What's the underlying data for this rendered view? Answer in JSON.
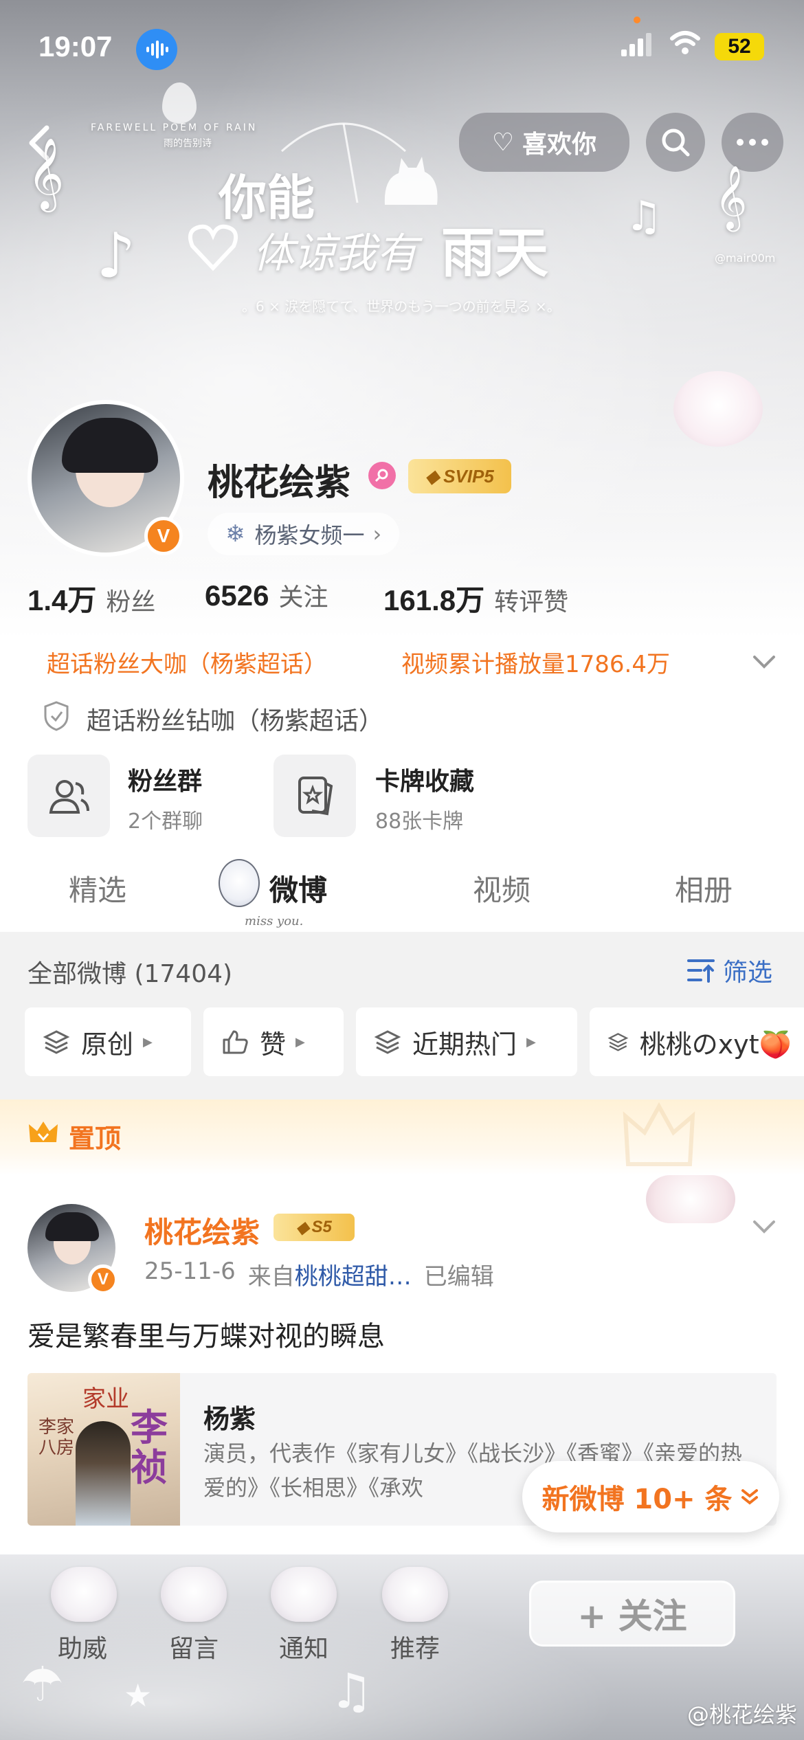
{
  "status_bar": {
    "time": "19:07",
    "battery": "52"
  },
  "hero": {
    "like_you": "喜欢你",
    "small_brand": "FAREWELL POEM OF RAIN",
    "small_brand_cn": "雨的告别诗",
    "title_line1": "你能",
    "title_line2_a": "体谅我有",
    "title_line2_b": "雨天",
    "subtitle": "。6 × 涙を隠てて、世界のもう一つの前を見る ×。",
    "watermark": "@mair00m"
  },
  "profile": {
    "name": "桃花绘紫",
    "verified_badge": "V",
    "svip": "SVIP5",
    "group_tag": "杨紫女频一",
    "stats": [
      {
        "num": "1.4万",
        "label": "粉丝"
      },
      {
        "num": "6526",
        "label": "关注"
      },
      {
        "num": "161.8万",
        "label": "转评赞"
      }
    ],
    "honors": [
      "超话粉丝大咖（杨紫超话）",
      "视频累计播放量1786.4万"
    ],
    "diamond": "超话粉丝钻咖（杨紫超话）",
    "features": [
      {
        "title": "粉丝群",
        "sub": "2个群聊"
      },
      {
        "title": "卡牌收藏",
        "sub": "88张卡牌"
      }
    ]
  },
  "tabs": [
    "精选",
    "微博",
    "视频",
    "相册"
  ],
  "tab_deco": "miss you.",
  "filter": {
    "all_label": "全部微博 (17404)",
    "filter_btn": "筛选",
    "chips": [
      "原创",
      "赞",
      "近期热门",
      "桃桃のxyt🍑"
    ]
  },
  "pinned": {
    "label": "置顶"
  },
  "post": {
    "author": "桃花绘紫",
    "level": "S5",
    "date": "25-11-6",
    "from_prefix": "来自",
    "from_source": "桃桃超甜…",
    "edited": "已编辑",
    "text": "爱是繁春里与万蝶对视的瞬息",
    "card": {
      "title": "杨紫",
      "desc": "演员，代表作《家有儿女》《战长沙》《香蜜》《亲爱的热爱的》《长相思》《承欢",
      "thumb_text_1": "家业",
      "thumb_text_2": "李祯",
      "thumb_text_3": "李家八房"
    }
  },
  "new_posts": "新微博 10+ 条",
  "bottom": {
    "items": [
      "助威",
      "留言",
      "通知",
      "推荐"
    ],
    "follow": "+ 关注",
    "watermark": "@桃花绘紫"
  },
  "colors": {
    "accent": "#f27420",
    "link": "#2f5aa8",
    "filter_blue": "#3b6fc5"
  }
}
